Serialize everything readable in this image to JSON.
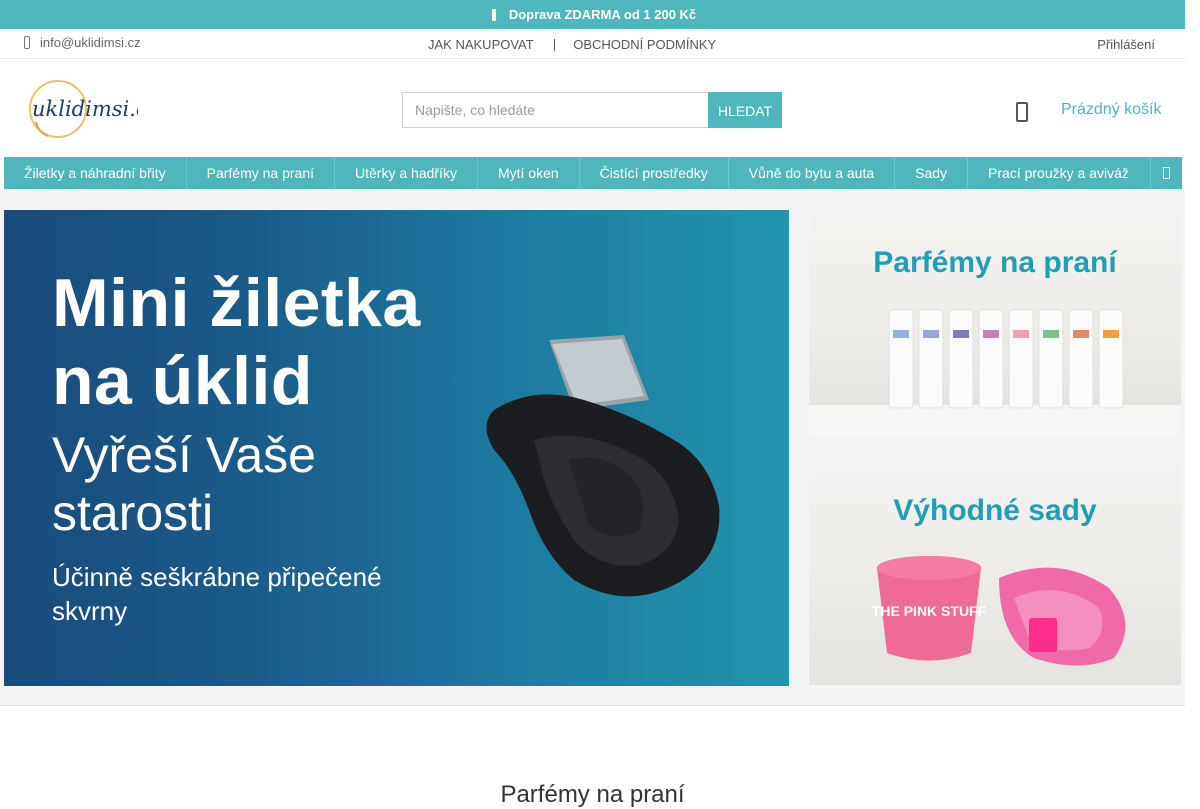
{
  "topbar": {
    "shipping": "Doprava ZDARMA od 1 200 Kč"
  },
  "subbar": {
    "email": "info@uklidimsi.cz",
    "links": [
      "JAK NAKUPOVAT",
      "OBCHODNÍ PODMÍNKY"
    ],
    "login": "Přihlášení"
  },
  "header": {
    "logo_text": "uklidimsi.cz",
    "search_placeholder": "Napište, co hledáte",
    "search_button": "HLEDAT",
    "cart_label": "Prázdný košík"
  },
  "nav": {
    "items": [
      "Žiletky a náhradní břity",
      "Parfémy na praní",
      "Utěrky a hadříky",
      "Mytí oken",
      "Čistící prostředky",
      "Vůně do bytu a auta",
      "Sady",
      "Prací proužky a aviváž"
    ]
  },
  "banners": {
    "main": {
      "line1": "Mini žiletka",
      "line2": "na úklid",
      "line3": "Vyřeší Vaše",
      "line4": "starosti",
      "line5": "Účinně seškrábne připečené",
      "line6": "skvrny"
    },
    "side1": {
      "title": "Parfémy na praní"
    },
    "side2": {
      "title": "Výhodné sady",
      "product_text": "THE PINK STUFF"
    }
  },
  "section": {
    "title": "Parfémy na praní"
  },
  "colors": {
    "accent": "#4fb6bd",
    "banner_title": "#1f9fb3"
  },
  "icons": {
    "shipping": "truck-icon",
    "email": "phone-icon",
    "cart": "cart-icon",
    "nav_more": "chevron-right-icon"
  }
}
